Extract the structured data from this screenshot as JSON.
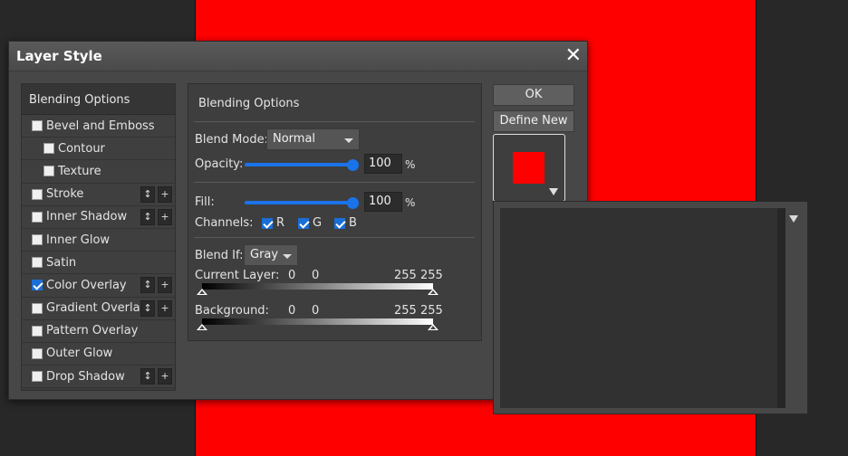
{
  "dialog": {
    "title": "Layer Style",
    "close_symbol": "✕"
  },
  "style_list": {
    "header": "Blending Options",
    "items": [
      {
        "label": "Bevel and Emboss",
        "checked": false,
        "indent": false,
        "controls": false
      },
      {
        "label": "Contour",
        "checked": false,
        "indent": true,
        "controls": false
      },
      {
        "label": "Texture",
        "checked": false,
        "indent": true,
        "controls": false
      },
      {
        "label": "Stroke",
        "checked": false,
        "indent": false,
        "controls": true
      },
      {
        "label": "Inner Shadow",
        "checked": false,
        "indent": false,
        "controls": true
      },
      {
        "label": "Inner Glow",
        "checked": false,
        "indent": false,
        "controls": false
      },
      {
        "label": "Satin",
        "checked": false,
        "indent": false,
        "controls": false
      },
      {
        "label": "Color Overlay",
        "checked": true,
        "indent": false,
        "controls": true
      },
      {
        "label": "Gradient Overlay",
        "checked": false,
        "indent": false,
        "controls": true
      },
      {
        "label": "Pattern Overlay",
        "checked": false,
        "indent": false,
        "controls": false
      },
      {
        "label": "Outer Glow",
        "checked": false,
        "indent": false,
        "controls": false
      },
      {
        "label": "Drop Shadow",
        "checked": false,
        "indent": false,
        "controls": true
      }
    ],
    "move_symbol": "↕",
    "add_symbol": "+"
  },
  "options": {
    "title": "Blending Options",
    "blend_mode_label": "Blend Mode:",
    "blend_mode_value": "Normal",
    "opacity_label": "Opacity:",
    "opacity_value": "100",
    "fill_label": "Fill:",
    "fill_value": "100",
    "percent": "%",
    "channels_label": "Channels:",
    "channel_r": "R",
    "channel_g": "G",
    "channel_b": "B",
    "blend_if_label": "Blend If:",
    "blend_if_value": "Gray",
    "current_layer_label": "Current Layer:",
    "current_layer_low": "0",
    "current_layer_low2": "0",
    "current_layer_high": "255 255",
    "background_label": "Background:",
    "background_low": "0",
    "background_low2": "0",
    "background_high": "255 255"
  },
  "buttons": {
    "ok": "OK",
    "define_new": "Define New"
  },
  "colors": {
    "overlay_color": "#ff0000",
    "accent": "#1a73e8"
  }
}
